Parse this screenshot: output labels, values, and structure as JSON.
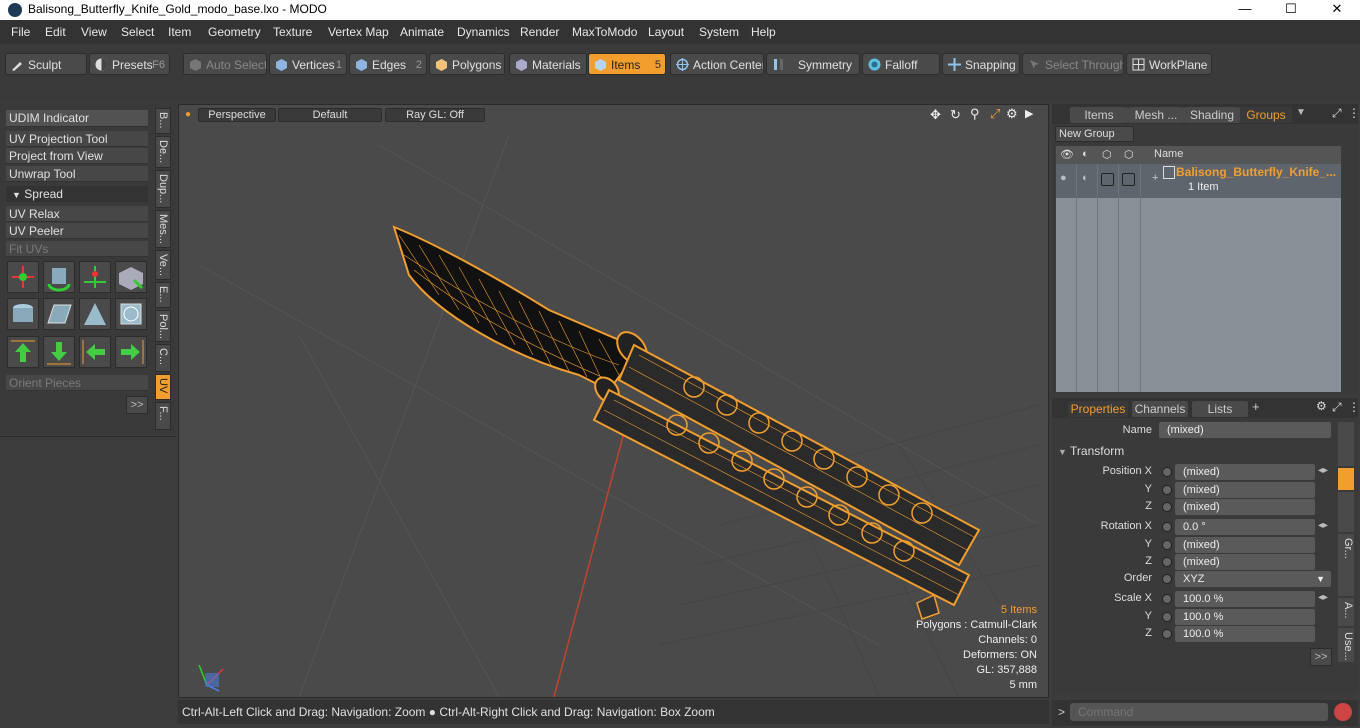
{
  "window": {
    "title": "Balisong_Butterfly_Knife_Gold_modo_base.lxo - MODO",
    "min": "—",
    "max": "☐",
    "close": "✕"
  },
  "menu": [
    "File",
    "Edit",
    "View",
    "Select",
    "Item",
    "Geometry",
    "Texture",
    "Vertex Map",
    "Animate",
    "Dynamics",
    "Render",
    "MaxToModo",
    "Layout",
    "System",
    "Help"
  ],
  "toolbar": {
    "sculpt": "Sculpt",
    "presets": "Presets",
    "presets_key": "F6",
    "auto_select": "Auto Select",
    "vertices": "Vertices",
    "vertices_key": "1",
    "edges": "Edges",
    "edges_key": "2",
    "polygons": "Polygons",
    "materials": "Materials",
    "items": "Items",
    "items_key": "5",
    "action_center": "Action Center",
    "symmetry": "Symmetry",
    "falloff": "Falloff",
    "snapping": "Snapping",
    "select_through": "Select Through",
    "workplane": "WorkPlane"
  },
  "left_panel": {
    "udim": "UDIM Indicator",
    "uv_projection": "UV Projection Tool",
    "project_from_view": "Project from View",
    "unwrap_tool": "Unwrap Tool",
    "spread": "Spread",
    "uv_relax": "UV Relax",
    "uv_peeler": "UV Peeler",
    "fit_uvs": "Fit UVs",
    "orient_pieces": "Orient Pieces",
    "more": ">>",
    "vtabs": [
      "B...",
      "De...",
      "Dup...",
      "Mes...",
      "Ve...",
      "E...",
      "Pol...",
      "C...",
      "UV",
      "F..."
    ]
  },
  "viewport": {
    "perspective": "Perspective",
    "default": "Default",
    "raygl": "Ray GL: Off",
    "info": {
      "items": "5 Items",
      "polygons": "Polygons : Catmull-Clark",
      "channels": "Channels: 0",
      "deformers": "Deformers: ON",
      "gl": "GL: 357,888",
      "scale": "5 mm"
    }
  },
  "status": {
    "hint": "Ctrl-Alt-Left Click and Drag: Navigation: Zoom ● Ctrl-Alt-Right Click and Drag: Navigation: Box Zoom"
  },
  "groups_panel": {
    "tabs": [
      "Items",
      "Mesh ...",
      "Shading",
      "Groups"
    ],
    "new_group": "New Group",
    "col_name": "Name",
    "row_name": "Balisong_Butterfly_Knife_...",
    "row_sub": "1 Item"
  },
  "properties_panel": {
    "tabs": [
      "Properties",
      "Channels",
      "Lists"
    ],
    "add": "+",
    "name_label": "Name",
    "name_value": "(mixed)",
    "transform": "Transform",
    "position_x_label": "Position X",
    "position_x": "(mixed)",
    "position_y": "(mixed)",
    "position_z": "(mixed)",
    "rotation_x_label": "Rotation X",
    "rotation_x": "0.0 °",
    "rotation_y": "(mixed)",
    "rotation_z": "(mixed)",
    "order_label": "Order",
    "order_value": "XYZ",
    "scale_x_label": "Scale X",
    "scale_x": "100.0 %",
    "scale_y": "100.0 %",
    "scale_z": "100.0 %",
    "y_label": "Y",
    "z_label": "Z",
    "more": ">>",
    "side_tabs": [
      "Gr...",
      "A...",
      "Use..."
    ]
  },
  "command": {
    "prompt": ">",
    "placeholder": "Command"
  },
  "colors": {
    "accent": "#f29e2e",
    "panel": "#3a3a3a",
    "viewport": "#4a4a4a"
  }
}
